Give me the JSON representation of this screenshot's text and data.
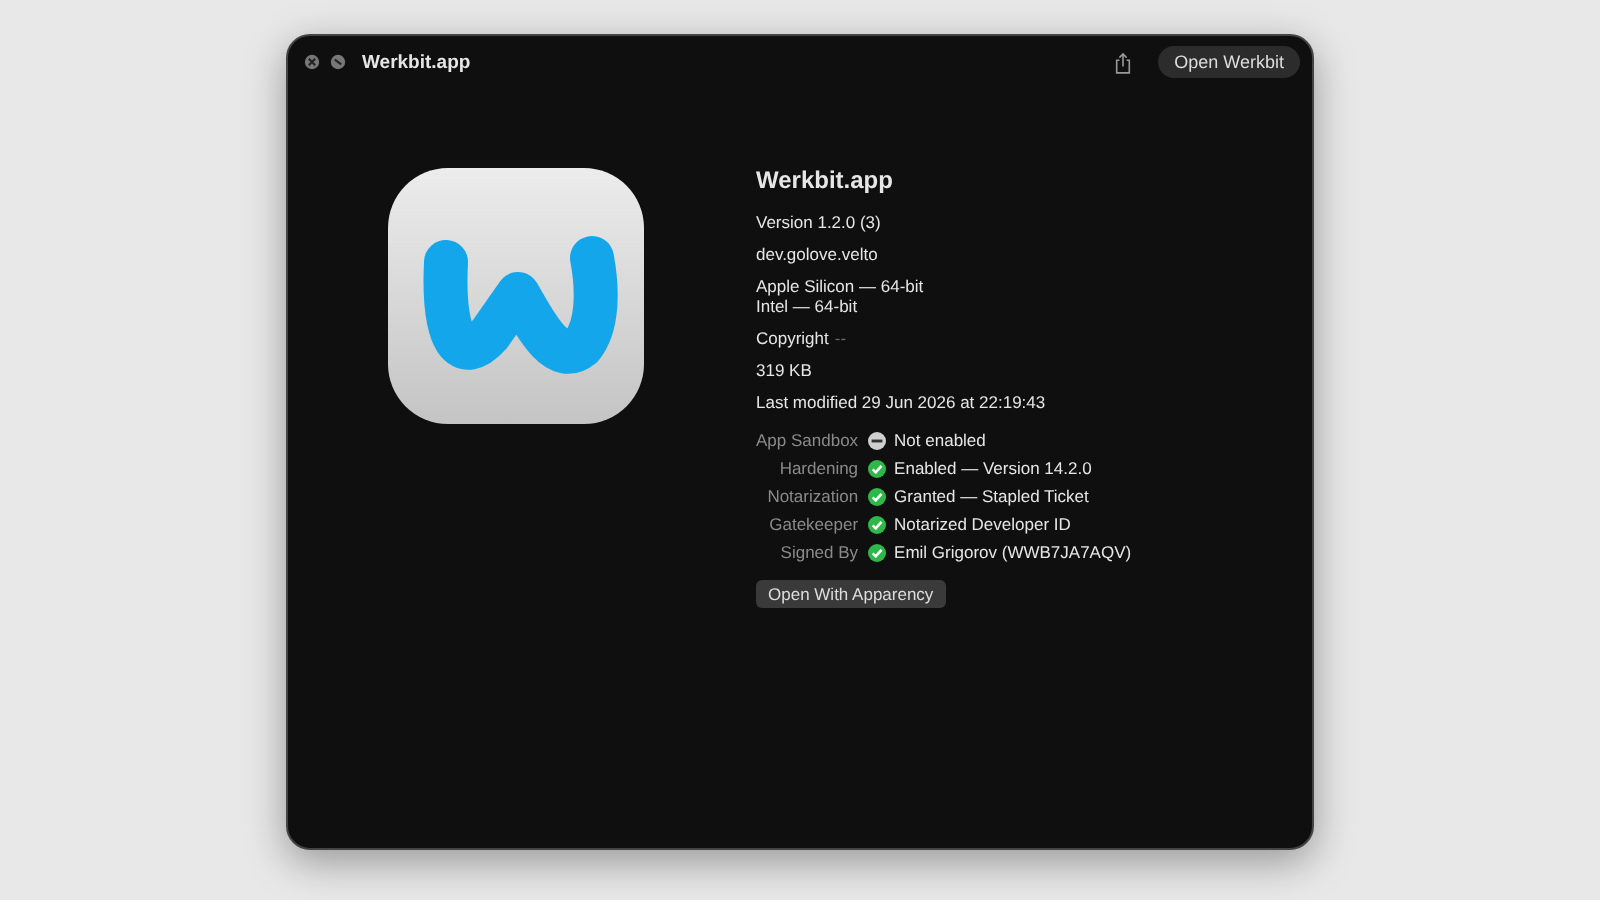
{
  "window": {
    "title": "Werkbit.app",
    "open_button": "Open Werkbit"
  },
  "info": {
    "name": "Werkbit.app",
    "version": "Version 1.2.0 (3)",
    "bundle_id": "dev.golove.velto",
    "architectures": [
      "Apple Silicon — 64-bit",
      "Intel — 64-bit"
    ],
    "copyright_label": "Copyright",
    "copyright_value": "--",
    "size": "319 KB",
    "modified": "Last modified 29 Jun 2026 at 22:19:43"
  },
  "security": [
    {
      "label": "App Sandbox",
      "kind": "off",
      "value": "Not enabled"
    },
    {
      "label": "Hardening",
      "kind": "ok",
      "value": "Enabled — Version 14.2.0"
    },
    {
      "label": "Notarization",
      "kind": "ok",
      "value": "Granted — Stapled Ticket"
    },
    {
      "label": "Gatekeeper",
      "kind": "ok",
      "value": "Notarized Developer ID"
    },
    {
      "label": "Signed By",
      "kind": "ok",
      "value": "Emil Grigorov (WWB7JA7AQV)"
    }
  ],
  "action_button": "Open With Apparency"
}
